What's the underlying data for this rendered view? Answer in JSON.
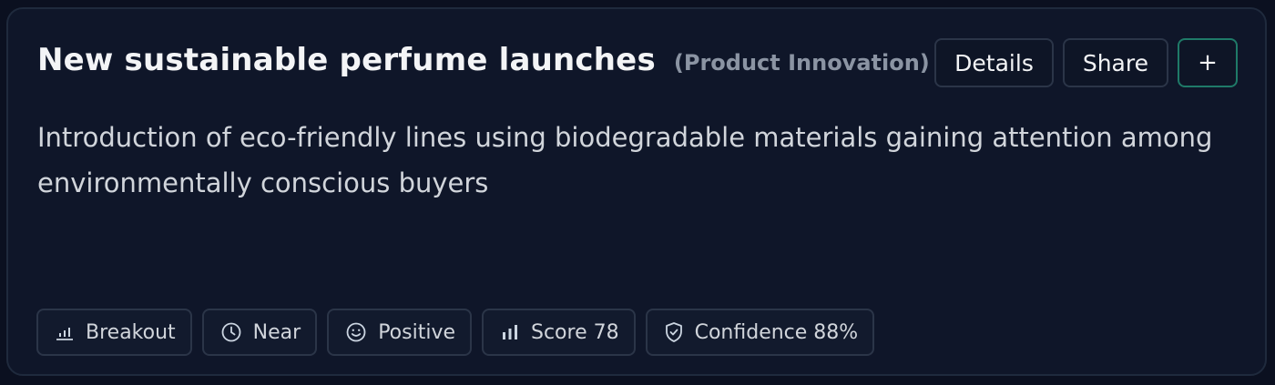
{
  "card": {
    "title": "New sustainable perfume launches",
    "category": "(Product Innovation)",
    "description": "Introduction of eco-friendly lines using biodegradable materials gaining attention among environmentally conscious buyers",
    "actions": {
      "details_label": "Details",
      "share_label": "Share",
      "add_label": "+"
    },
    "chips": [
      {
        "icon": "bar-chart-icon",
        "label": "Breakout"
      },
      {
        "icon": "clock-icon",
        "label": "Near"
      },
      {
        "icon": "smiley-icon",
        "label": "Positive"
      },
      {
        "icon": "signal-bars-icon",
        "label": "Score 78"
      },
      {
        "icon": "shield-check-icon",
        "label": "Confidence 88%"
      }
    ]
  },
  "colors": {
    "background": "#0b1020",
    "card": "#0f1629",
    "border": "#1f2a3d",
    "accent": "#1f7a68",
    "muted_text": "#8b94a3"
  }
}
